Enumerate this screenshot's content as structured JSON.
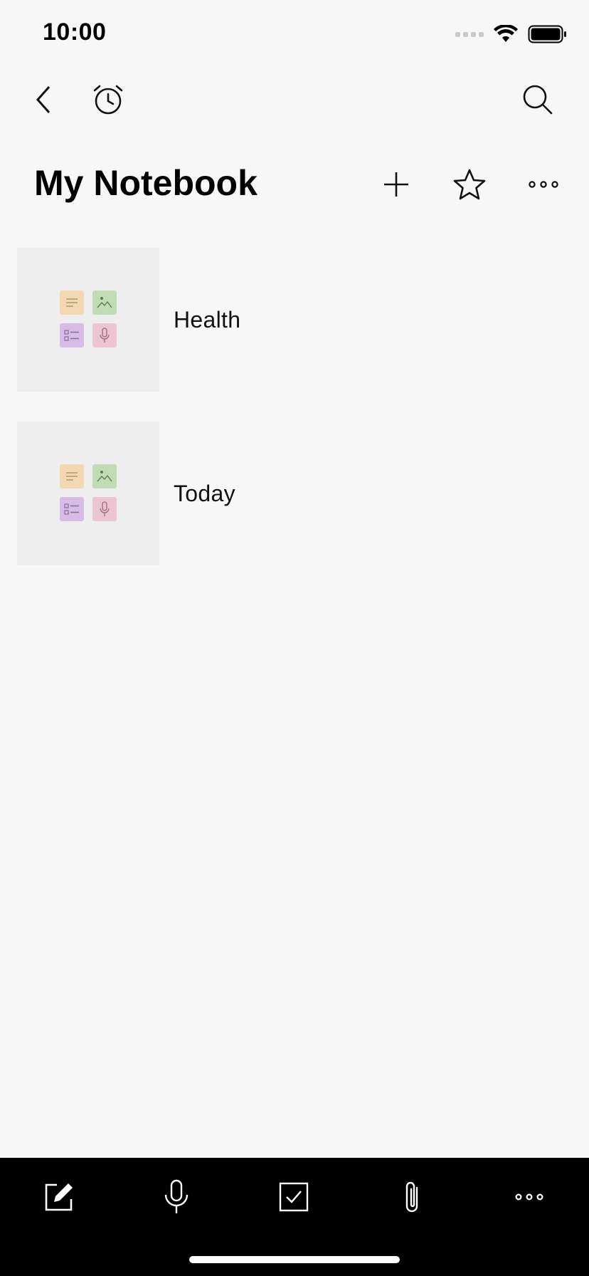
{
  "status_bar": {
    "time": "10:00"
  },
  "top_nav": {
    "back_icon": "chevron-left-icon",
    "reminder_icon": "alarm-clock-icon",
    "search_icon": "search-icon"
  },
  "header": {
    "title": "My Notebook",
    "add_icon": "plus-icon",
    "favorite_icon": "star-icon",
    "more_icon": "ellipsis-icon"
  },
  "notebooks": [
    {
      "label": "Health"
    },
    {
      "label": "Today"
    }
  ],
  "bottom_bar": {
    "items": [
      {
        "icon": "pencil-note-icon"
      },
      {
        "icon": "microphone-icon"
      },
      {
        "icon": "checkbox-icon"
      },
      {
        "icon": "paperclip-icon"
      },
      {
        "icon": "ellipsis-icon"
      }
    ]
  },
  "colors": {
    "background": "#f7f7f7",
    "thumbnail_bg": "#eeeeee",
    "tile_text": "#f2d7b3",
    "tile_image": "#bfdcb5",
    "tile_checklist": "#d7bde6",
    "tile_audio": "#ecc5d3",
    "bottom_bar": "#000000"
  }
}
